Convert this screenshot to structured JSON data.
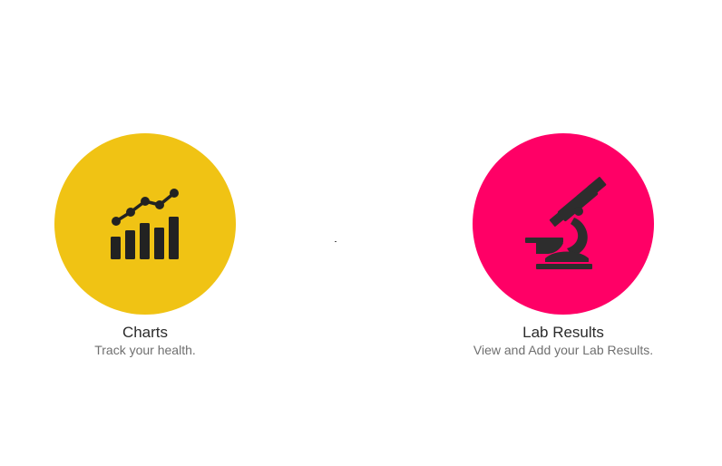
{
  "tiles": [
    {
      "title": "Charts",
      "subtitle": "Track your health.",
      "icon": "chart-icon",
      "color": "#f0c314"
    },
    {
      "title": "Lab Results",
      "subtitle": "View and Add your Lab Results.",
      "icon": "microscope-icon",
      "color": "#ff0066"
    }
  ],
  "colors": {
    "background": "#ffffff",
    "icon": "#222222",
    "title": "#2b2b2b",
    "subtitle": "#6f6f6f"
  }
}
